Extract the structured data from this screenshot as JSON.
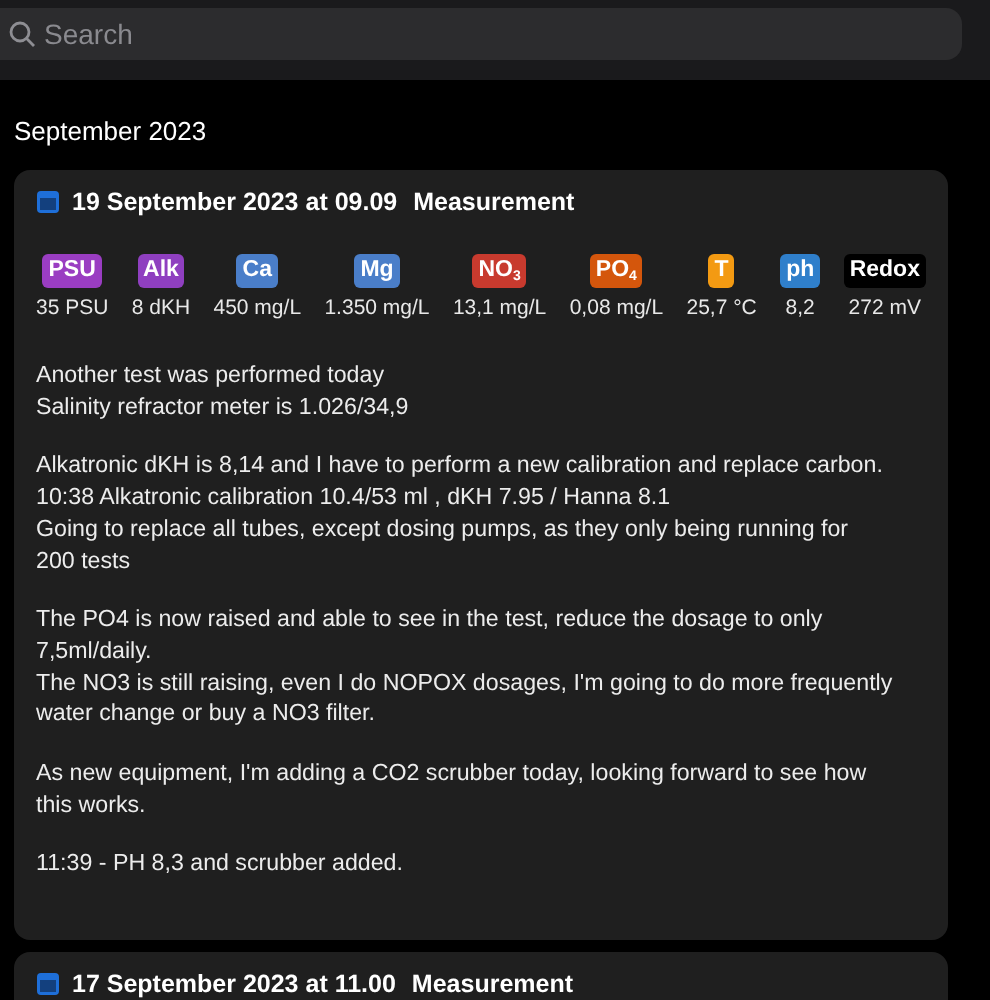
{
  "search": {
    "placeholder": "Search"
  },
  "section_title": "September 2023",
  "entries": [
    {
      "date": "19 September 2023 at 09.09",
      "type": "Measurement",
      "parameters": [
        {
          "label": "PSU",
          "color": "#9a3dc2",
          "value": "35 PSU"
        },
        {
          "label": "Alk",
          "color": "#8f3fc0",
          "value": "8 dKH"
        },
        {
          "label": "Ca",
          "color": "#4a7ec9",
          "value": "450 mg/L"
        },
        {
          "label": "Mg",
          "color": "#4a7ec9",
          "value": "1.350 mg/L"
        },
        {
          "label": "NO$_{3}$",
          "color": "#c83a2e",
          "value": "13,1 mg/L"
        },
        {
          "label": "PO$_{4}$",
          "color": "#d4560c",
          "value": "0,08 mg/L"
        },
        {
          "label": "T",
          "color": "#f39a12",
          "value": "25,7 °C"
        },
        {
          "label": "ph",
          "color": "#2f7fcb",
          "value": "8,2"
        },
        {
          "label": "Redox",
          "color": "#000000",
          "value": "272 mV"
        }
      ],
      "notes": [
        [
          "Another test was performed today",
          "Salinity refractor meter is 1.026/34,9"
        ],
        [
          "Alkatronic dKH is 8,14 and I have to perform a new calibration and replace carbon.",
          "10:38 Alkatronic calibration 10.4/53 ml , dKH 7.95 / Hanna 8.1",
          "Going to replace all tubes, except dosing pumps, as they only being running for",
          "200 tests"
        ],
        [
          "The PO4 is now raised and able to see in the test, reduce the dosage to only",
          "7,5ml/daily.",
          "The NO3 is still raising, even I do NOPOX dosages, I'm going to do more frequently",
          "water change or buy a NO3 filter."
        ],
        [
          "As new equipment, I'm adding a CO2 scrubber today, looking forward to see how",
          "this works."
        ],
        [
          "11:39 - PH 8,3 and scrubber added."
        ]
      ]
    },
    {
      "date": "17 September 2023 at 11.00",
      "type": "Measurement"
    }
  ]
}
